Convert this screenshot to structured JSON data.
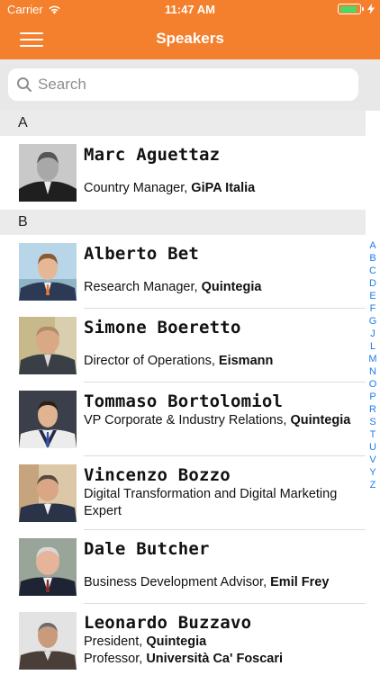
{
  "status": {
    "carrier": "Carrier",
    "time": "11:47 AM",
    "battery_level": 0.9
  },
  "nav": {
    "title": "Speakers",
    "menu_icon": "hamburger-menu-icon"
  },
  "search": {
    "placeholder": "Search",
    "value": ""
  },
  "sections": [
    {
      "letter": "A",
      "speakers": [
        {
          "name": "Marc Aguettaz",
          "role_prefix": "Country Manager, ",
          "company": "GiPA Italia"
        }
      ]
    },
    {
      "letter": "B",
      "speakers": [
        {
          "name": "Alberto Bet",
          "role_prefix": "Research Manager, ",
          "company": "Quintegia"
        },
        {
          "name": "Simone Boeretto",
          "role_prefix": "Director of Operations, ",
          "company": "Eismann"
        },
        {
          "name": "Tommaso Bortolomiol",
          "role_prefix": "VP Corporate & Industry Relations, ",
          "company": "Quintegia"
        },
        {
          "name": "Vincenzo Bozzo",
          "role_prefix": "Digital Transformation and Digital Marketing Expert",
          "company": ""
        },
        {
          "name": "Dale Butcher",
          "role_prefix": "Business Development Advisor, ",
          "company": "Emil Frey"
        },
        {
          "name": "Leonardo Buzzavo",
          "role_prefix": "President, ",
          "company": "Quintegia",
          "role2_prefix": "Professor, ",
          "company2": "Università Ca' Foscari"
        }
      ]
    }
  ],
  "index_letters": [
    "A",
    "B",
    "C",
    "D",
    "E",
    "F",
    "G",
    "J",
    "L",
    "M",
    "N",
    "O",
    "P",
    "R",
    "S",
    "T",
    "U",
    "V",
    "Y",
    "Z"
  ],
  "colors": {
    "accent": "#f47f2c",
    "index": "#1e7cf2"
  }
}
